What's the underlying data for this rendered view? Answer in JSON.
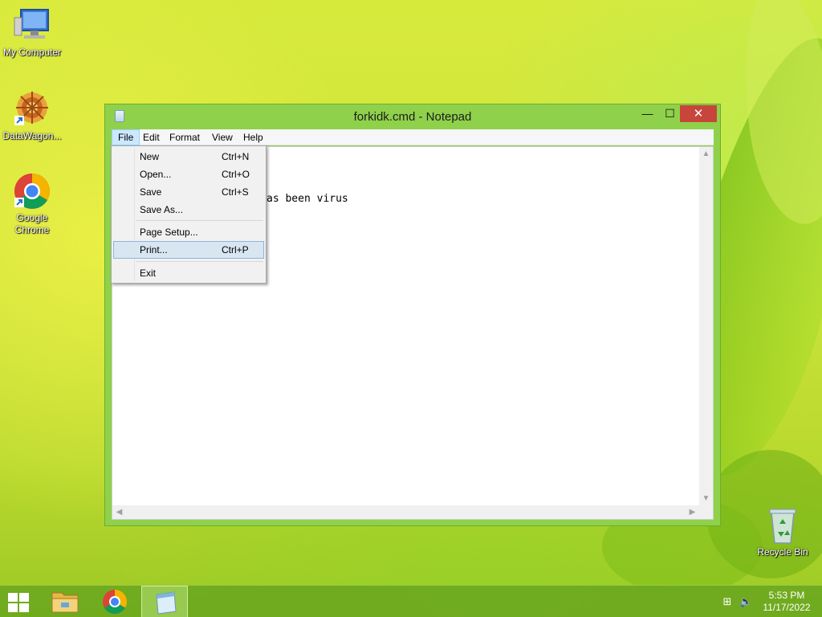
{
  "desktop": {
    "icons": [
      {
        "label": "My Computer"
      },
      {
        "label": "DataWagon..."
      },
      {
        "label": "Google Chrome"
      },
      {
        "label": "Recycle Bin"
      }
    ]
  },
  "window": {
    "title": "forkidk.cmd - Notepad",
    "controls": {
      "minimize": "—",
      "maximize": "☐",
      "close": "✕"
    },
    "menu": [
      "File",
      "Edit",
      "Format",
      "View",
      "Help"
    ],
    "editor_text": "as been virus"
  },
  "file_menu": {
    "items": [
      {
        "label": "New",
        "shortcut": "Ctrl+N"
      },
      {
        "label": "Open...",
        "shortcut": "Ctrl+O"
      },
      {
        "label": "Save",
        "shortcut": "Ctrl+S"
      },
      {
        "label": "Save As...",
        "shortcut": ""
      },
      {
        "label": "Page Setup...",
        "shortcut": ""
      },
      {
        "label": "Print...",
        "shortcut": "Ctrl+P"
      },
      {
        "label": "Exit",
        "shortcut": ""
      }
    ],
    "highlighted": "Print..."
  },
  "taskbar": {
    "apps": [
      "file-explorer",
      "google-chrome",
      "notepad"
    ],
    "active_app": "notepad",
    "clock": {
      "time": "5:53 PM",
      "date": "11/17/2022"
    }
  },
  "colors": {
    "window_frame": "#8fd14a",
    "close_button": "#c7453a",
    "menu_highlight": "#d8e6f2",
    "taskbar": "#6ca81e"
  }
}
